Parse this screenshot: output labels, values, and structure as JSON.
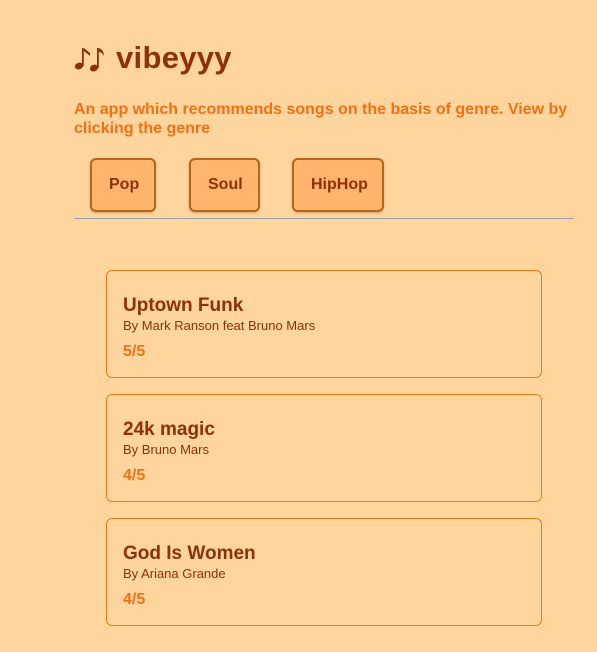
{
  "app": {
    "title_icon": "music-notes-icon",
    "title": "vibeyyy",
    "subtitle": "An app which recommends songs on the basis of genre. View by clicking the genre"
  },
  "genres": [
    {
      "label": "Pop"
    },
    {
      "label": "Soul"
    },
    {
      "label": "HipHop"
    }
  ],
  "songs": [
    {
      "name": "Uptown Funk",
      "artist": "By Mark Ranson feat Bruno Mars",
      "rating": "5/5"
    },
    {
      "name": "24k magic",
      "artist": "By Bruno Mars",
      "rating": "4/5"
    },
    {
      "name": "God Is Women",
      "artist": "By Ariana Grande",
      "rating": "4/5"
    }
  ],
  "colors": {
    "background": "#ffd59e",
    "title": "#8f2f0c",
    "accent": "#f56f14",
    "button_bg": "#ffb56b",
    "button_border": "#b5651d",
    "card_border": "#f07a1c"
  }
}
